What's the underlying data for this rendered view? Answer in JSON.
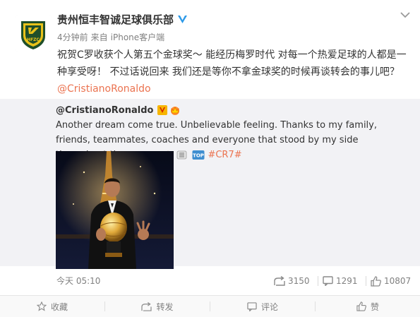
{
  "post": {
    "author": "贵州恒丰智诚足球俱乐部",
    "avatar_text": "HFZC",
    "time": "4分钟前",
    "source_prefix": "来自",
    "source": "iPhone客户端",
    "text_main": "祝贺C罗收获个人第五个金球奖～ 能经历梅罗时代 对每一个热爱足球的人都是一种享受呀！ 不过话说回来 我们还是等你不拿金球奖的时候再谈转会的事儿吧？",
    "mention": "@CristianoRonaldo"
  },
  "repost": {
    "author": "@CristianoRonaldo",
    "text": "Another dream come true. Unbelievable feeling. Thanks to my family, friends, teammates, coaches and everyone that stood by my side throughout the years.",
    "hashtag": "#CR7#",
    "top_badge": "TOP"
  },
  "stats": {
    "time": "今天 05:10",
    "forwards": "3150",
    "comments": "1291",
    "likes": "10807"
  },
  "actions": {
    "favorite": "收藏",
    "forward": "转发",
    "comment": "评论",
    "like": "赞"
  },
  "colors": {
    "link": "#eb7350",
    "muted": "#808080",
    "repost_bg": "#f2f2f5",
    "verified": "#2d9ae8"
  },
  "icons": [
    "chevron-down-icon",
    "verified-icon",
    "crown-icon",
    "ok-hand-emoji",
    "sparkle-emoji",
    "top-emoji",
    "forward-icon",
    "comment-icon",
    "like-icon",
    "star-icon"
  ]
}
